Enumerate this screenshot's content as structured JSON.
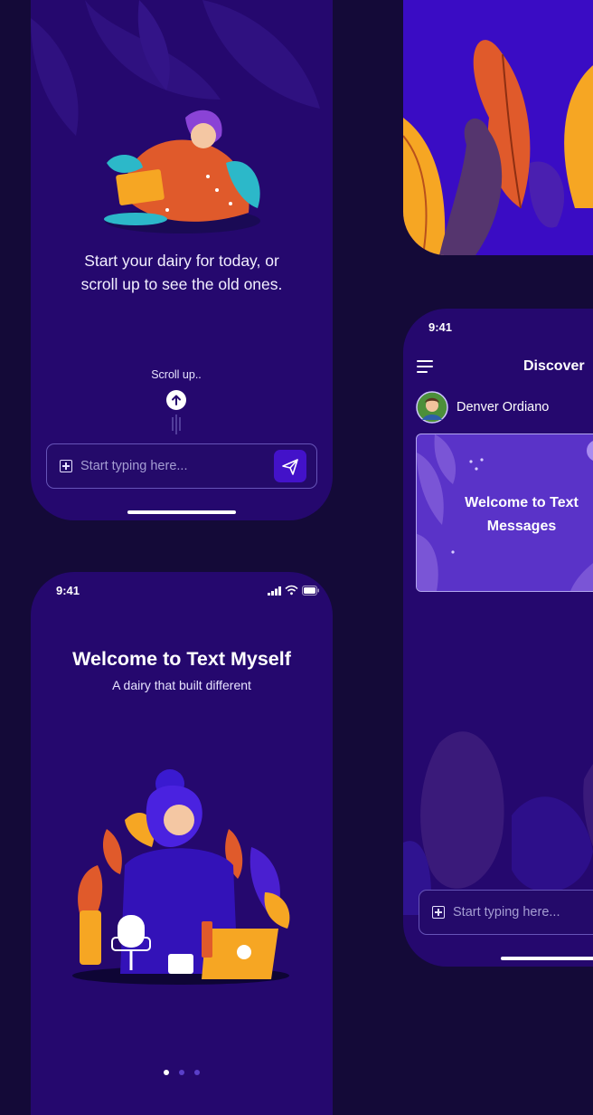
{
  "theme": {
    "background": "#140a38",
    "phone": "#25086e",
    "accent": "#4312c9",
    "leaf_orange": "#e05a2b",
    "leaf_yellow": "#f6a623"
  },
  "screen_diary": {
    "caption_line1": "Start your dairy for today, or",
    "caption_line2": "scroll up to see the old ones.",
    "scroll_label": "Scroll up..",
    "scroll_icon": "arrow-up-icon",
    "input": {
      "icon": "plus-square-icon",
      "placeholder": "Start typing here...",
      "send_icon": "send-icon"
    }
  },
  "screen_discover": {
    "status_time": "9:41",
    "menu_icon": "hamburger-menu-icon",
    "header_title": "Discover",
    "user_name": "Denver Ordiano",
    "card_line1": "Welcome to Text",
    "card_line2": "Messages",
    "input": {
      "icon": "plus-square-icon",
      "placeholder": "Start typing here..."
    }
  },
  "screen_welcome": {
    "status_time": "9:41",
    "status_icons": [
      "signal-icon",
      "wifi-icon",
      "battery-icon"
    ],
    "title": "Welcome to Text Myself",
    "subtitle": "A dairy that built different",
    "pagination": {
      "total": 3,
      "active": 1
    }
  }
}
